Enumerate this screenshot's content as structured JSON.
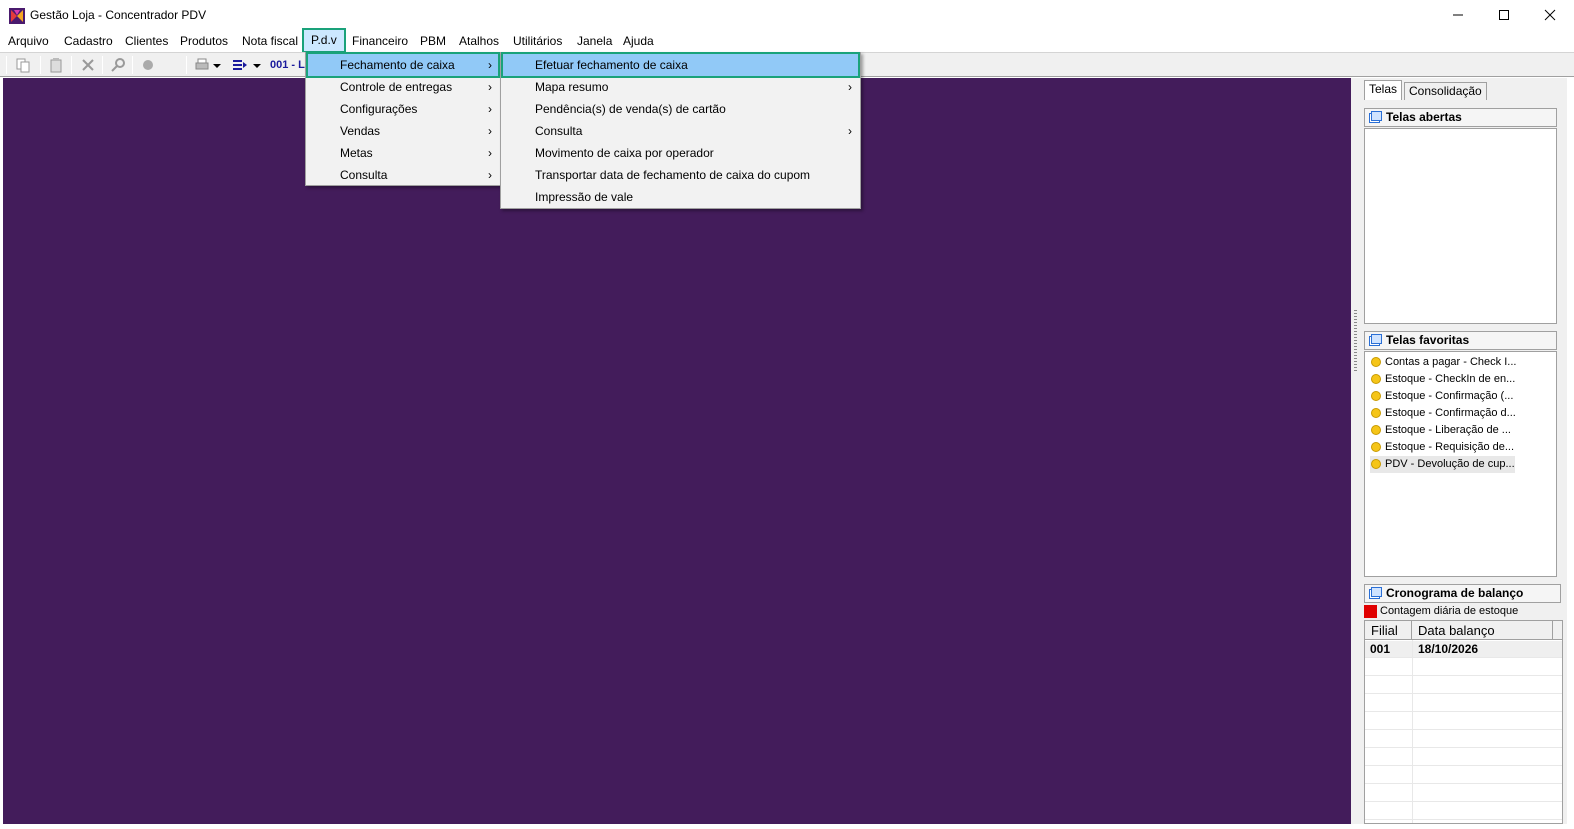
{
  "window": {
    "title": "Gestão Loja - Concentrador PDV",
    "icons": {
      "logo": "app-logo-icon",
      "minimize": "minimize-icon",
      "maximize": "maximize-icon",
      "close": "close-icon"
    }
  },
  "menubar": {
    "items": [
      "Arquivo",
      "Cadastro",
      "Clientes",
      "Produtos",
      "Nota fiscal",
      "P.d.v",
      "Financeiro",
      "PBM",
      "Atalhos",
      "Utilitários",
      "Janela",
      "Ajuda"
    ],
    "active": "P.d.v"
  },
  "toolbar": {
    "filial_label": "001 - L",
    "icons": [
      "copy-icon",
      "paste-icon",
      "delete-icon",
      "search-icon",
      "record-icon",
      "print-icon",
      "export-icon"
    ]
  },
  "pdv_menu": {
    "items": [
      {
        "label": "Fechamento de caixa",
        "submenu": true
      },
      {
        "label": "Controle de entregas",
        "submenu": true
      },
      {
        "label": "Configurações",
        "submenu": true
      },
      {
        "label": "Vendas",
        "submenu": true
      },
      {
        "label": "Metas",
        "submenu": true
      },
      {
        "label": "Consulta",
        "submenu": true
      }
    ]
  },
  "fechamento_menu": {
    "items": [
      {
        "label": "Efetuar fechamento de caixa",
        "submenu": false
      },
      {
        "label": "Mapa resumo",
        "submenu": true
      },
      {
        "label": "Pendência(s) de venda(s) de  cartão",
        "submenu": false
      },
      {
        "label": "Consulta",
        "submenu": true
      },
      {
        "label": "Movimento de caixa por operador",
        "submenu": false
      },
      {
        "label": "Transportar data de fechamento de caixa do cupom",
        "submenu": false
      },
      {
        "label": "Impressão de vale",
        "submenu": false
      }
    ],
    "arrow": "›"
  },
  "right_panel": {
    "tabs": [
      "Telas",
      "Consolidação"
    ],
    "telas_abertas": {
      "title": "Telas abertas"
    },
    "telas_favoritas": {
      "title": "Telas favoritas",
      "items": [
        "Contas a pagar - Check I...",
        "Estoque - CheckIn de en...",
        "Estoque - Confirmação (...",
        "Estoque - Confirmação d...",
        "Estoque - Liberação de ...",
        "Estoque - Requisição de...",
        "PDV - Devolução de cup..."
      ]
    },
    "cronograma": {
      "title": "Cronograma de balanço",
      "legend": "Contagem diária de estoque",
      "legend_color": "#e00000",
      "columns": [
        "Filial",
        "Data balanço"
      ],
      "rows": [
        {
          "filial": "001",
          "data": "18/10/2026"
        }
      ]
    }
  },
  "colors": {
    "workspace": "#431c5b",
    "highlight": "#91c9f7",
    "highlight_border": "#1aa27a"
  }
}
